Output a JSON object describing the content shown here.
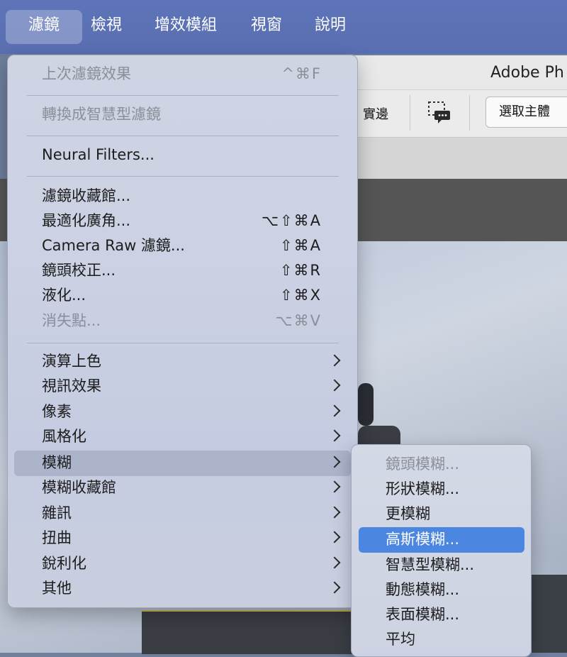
{
  "menubar": {
    "items": [
      {
        "label": "濾鏡",
        "active": true
      },
      {
        "label": "檢視"
      },
      {
        "label": "增效模組"
      },
      {
        "label": "視窗"
      },
      {
        "label": "說明"
      }
    ]
  },
  "window": {
    "title": "Adobe Ph",
    "options_label": "實邊",
    "select_subject_label": "選取主體",
    "speech_icon": "selection-speech-icon"
  },
  "filter_menu": {
    "items": [
      {
        "label": "上次濾鏡效果",
        "shortcut": "^⌘F",
        "disabled": true
      },
      {
        "label": "轉換成智慧型濾鏡",
        "shortcut": "",
        "disabled": true
      },
      {
        "label": "Neural Filters...",
        "shortcut": ""
      },
      {
        "label": "濾鏡收藏館...",
        "shortcut": ""
      },
      {
        "label": "最適化廣角...",
        "shortcut": "⌥⇧⌘A"
      },
      {
        "label": "Camera Raw 濾鏡...",
        "shortcut": "⇧⌘A"
      },
      {
        "label": "鏡頭校正...",
        "shortcut": "⇧⌘R"
      },
      {
        "label": "液化...",
        "shortcut": "⇧⌘X"
      },
      {
        "label": "消失點...",
        "shortcut": "⌥⌘V",
        "disabled": true
      },
      {
        "label": "演算上色",
        "submenu": true
      },
      {
        "label": "視訊效果",
        "submenu": true
      },
      {
        "label": "像素",
        "submenu": true
      },
      {
        "label": "風格化",
        "submenu": true
      },
      {
        "label": "模糊",
        "submenu": true,
        "highlighted": true
      },
      {
        "label": "模糊收藏館",
        "submenu": true
      },
      {
        "label": "雜訊",
        "submenu": true
      },
      {
        "label": "扭曲",
        "submenu": true
      },
      {
        "label": "銳利化",
        "submenu": true
      },
      {
        "label": "其他",
        "submenu": true
      }
    ]
  },
  "blur_submenu": {
    "items": [
      {
        "label": "鏡頭模糊...",
        "disabled": true
      },
      {
        "label": "形狀模糊..."
      },
      {
        "label": "更模糊"
      },
      {
        "label": "高斯模糊...",
        "selected": true
      },
      {
        "label": "智慧型模糊..."
      },
      {
        "label": "動態模糊..."
      },
      {
        "label": "表面模糊..."
      },
      {
        "label": "平均"
      }
    ]
  },
  "colors": {
    "menubar": "#5a6fb2",
    "selection": "#4b86e0"
  }
}
